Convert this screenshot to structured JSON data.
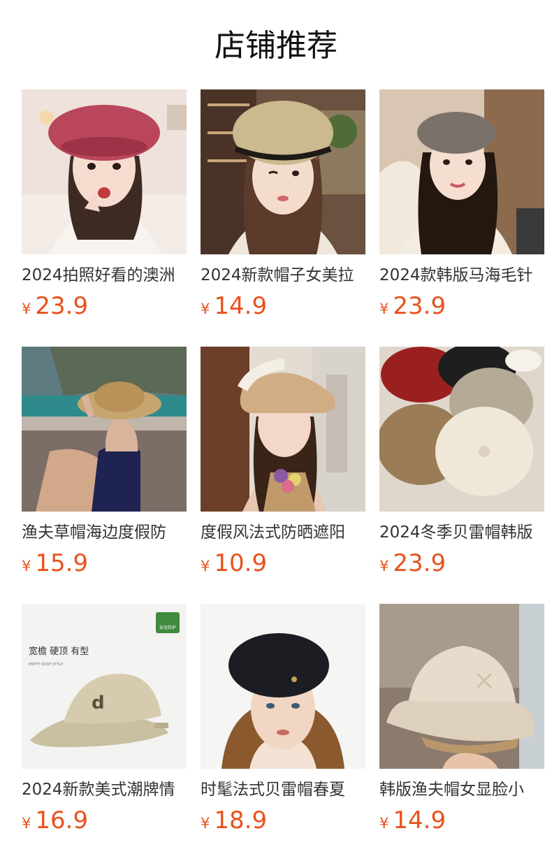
{
  "page_title": "店铺推荐",
  "products": [
    {
      "name": "2024拍照好看的澳洲",
      "currency": "¥",
      "price": "23.9",
      "image": "woman-red-beret"
    },
    {
      "name": "2024新款帽子女美拉",
      "currency": "¥",
      "price": "14.9",
      "image": "woman-straw-beret"
    },
    {
      "name": "2024款韩版马海毛针",
      "currency": "¥",
      "price": "23.9",
      "image": "woman-grey-beret"
    },
    {
      "name": "渔夫草帽海边度假防",
      "currency": "¥",
      "price": "15.9",
      "image": "woman-straw-bucket-boat"
    },
    {
      "name": "度假风法式防晒遮阳",
      "currency": "¥",
      "price": "10.9",
      "image": "woman-wide-straw-hat-flowers"
    },
    {
      "name": "2024冬季贝雷帽韩版",
      "currency": "¥",
      "price": "23.9",
      "image": "wool-berets-pile"
    },
    {
      "name": "2024新款美式潮牌情",
      "currency": "¥",
      "price": "16.9",
      "image": "khaki-baseball-cap",
      "overlay": {
        "headline": "宽檐 硬顶 有型",
        "subline": "EMPTY ROOF STYLE",
        "badge": "安全防护"
      }
    },
    {
      "name": "时髦法式贝雷帽春夏",
      "currency": "¥",
      "price": "18.9",
      "image": "woman-black-beret"
    },
    {
      "name": "韩版渔夫帽女显脸小",
      "currency": "¥",
      "price": "14.9",
      "image": "beige-bucket-hat-in-hand"
    }
  ]
}
